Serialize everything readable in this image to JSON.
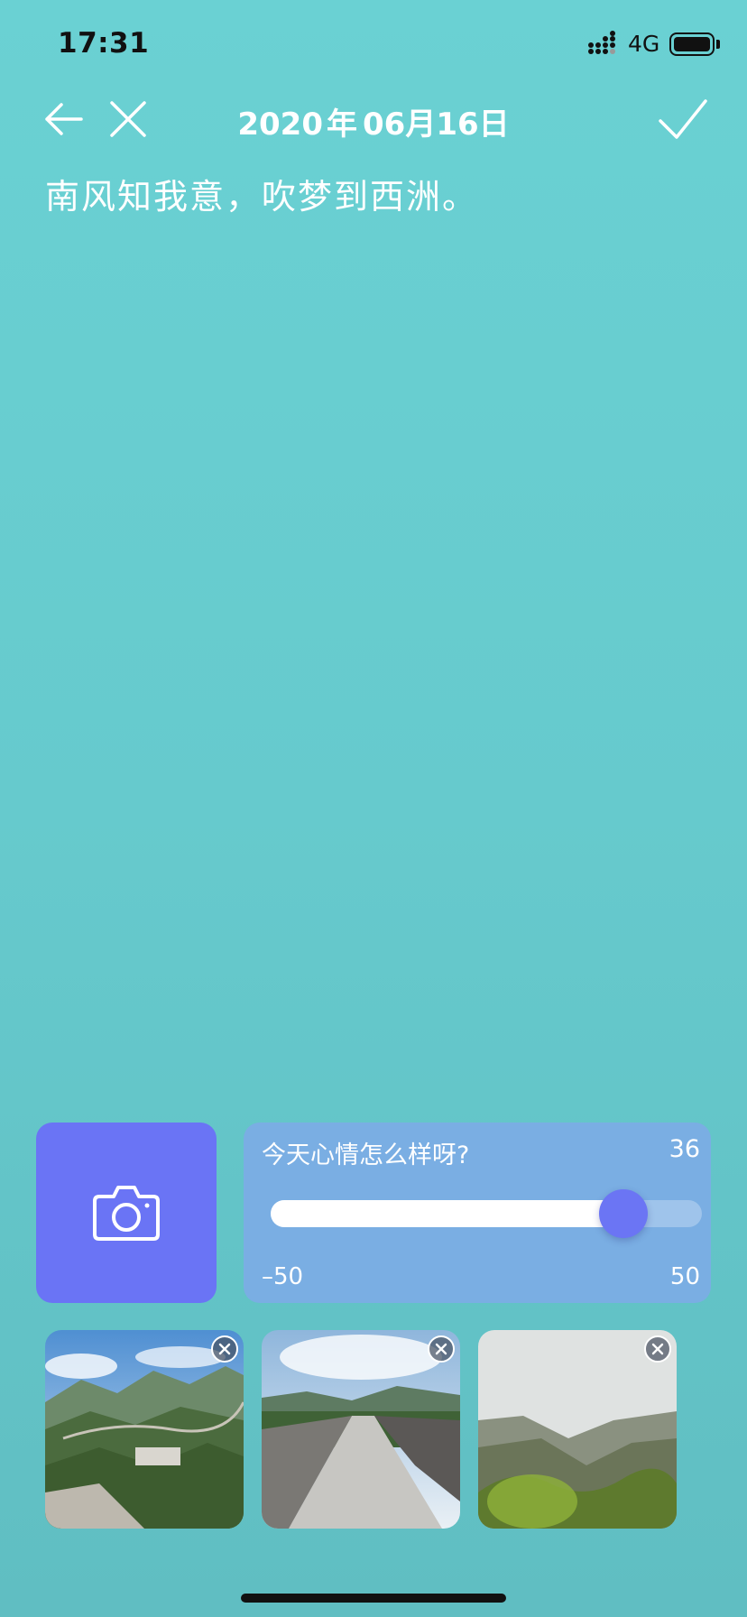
{
  "status_bar": {
    "time": "17:31",
    "network": "4G",
    "signal_icon": "signal-bars-icon",
    "battery_icon": "battery-full-icon"
  },
  "nav": {
    "back_icon": "arrow-left-icon",
    "close_icon": "close-icon",
    "confirm_icon": "checkmark-icon",
    "date": {
      "year": "2020",
      "year_unit": "年",
      "month": "06",
      "month_unit": "月",
      "day": "16",
      "day_unit": "日"
    }
  },
  "editor": {
    "text": "南风知我意，吹梦到西洲。"
  },
  "camera": {
    "icon": "camera-icon"
  },
  "mood": {
    "question": "今天心情怎么样呀?",
    "value": "36",
    "min_label": "–50",
    "max_label": "50",
    "range": [
      -50,
      50
    ],
    "current": 36,
    "accent": "#6b75f4"
  },
  "photos": [
    {
      "alt": "mountain-wall-photo",
      "remove_icon": "close-icon"
    },
    {
      "alt": "wall-walkway-photo",
      "remove_icon": "close-icon"
    },
    {
      "alt": "misty-mountains-photo",
      "remove_icon": "close-icon"
    }
  ],
  "colors": {
    "background": "#66cacd",
    "camera_tile": "#6a74f5",
    "mood_card": "#7aaee3"
  }
}
